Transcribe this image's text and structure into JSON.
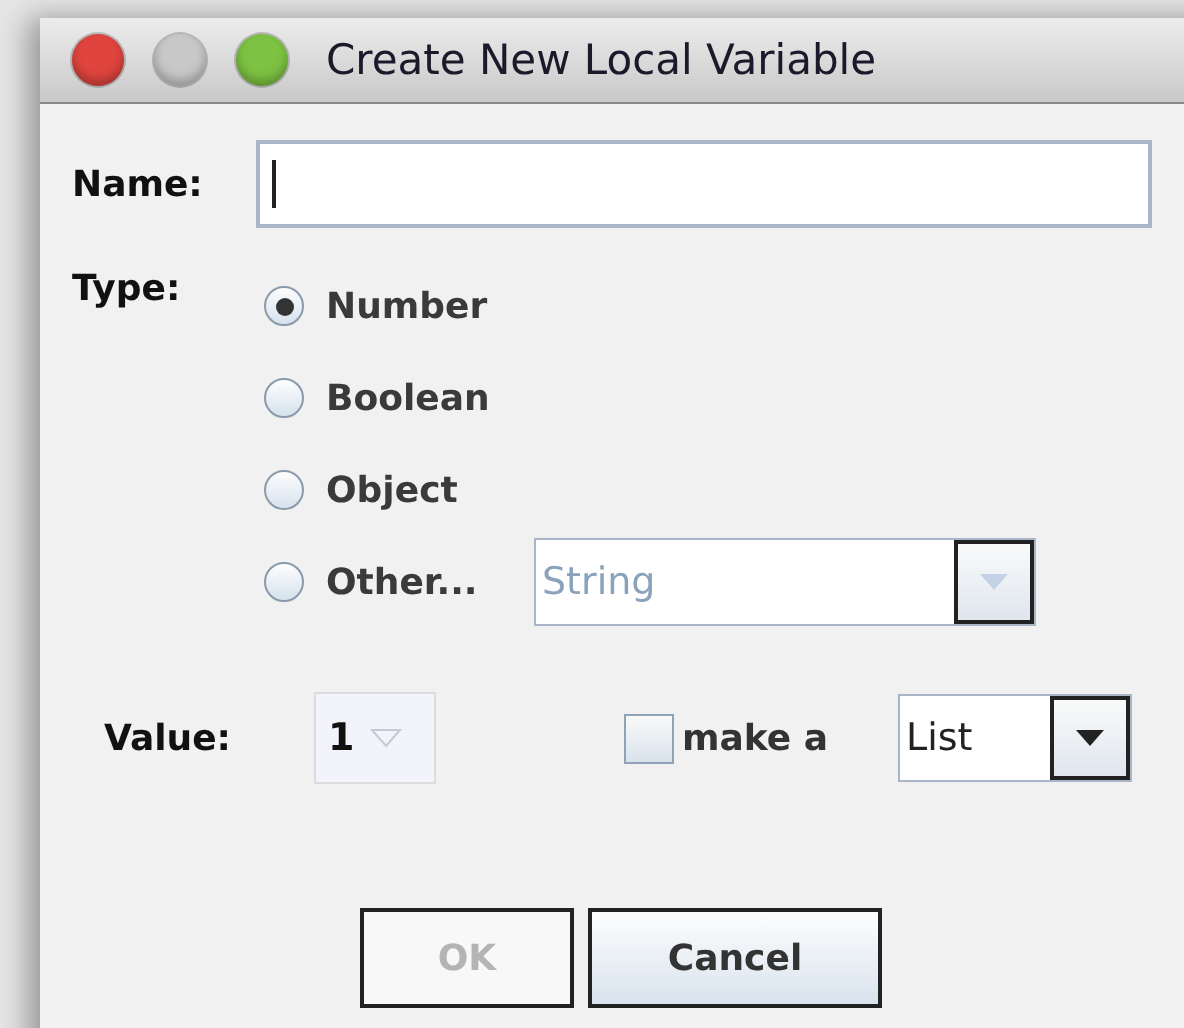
{
  "window": {
    "title": "Create New Local Variable",
    "controls": [
      {
        "color": "#e0443e"
      },
      {
        "color": "#c8c8c8"
      },
      {
        "color": "#7dc242"
      }
    ]
  },
  "name": {
    "label": "Name:",
    "focused": true
  },
  "type": {
    "label": "Type:",
    "options": [
      {
        "label": "Number",
        "selected": true
      },
      {
        "label": "Boolean",
        "selected": false
      },
      {
        "label": "Object",
        "selected": false
      },
      {
        "label": "Other...",
        "selected": false
      }
    ],
    "other_combo": {
      "value": "String",
      "disabled": true
    }
  },
  "value": {
    "label": "Value:",
    "value": "1",
    "disabled": true
  },
  "make_list": {
    "label": "make a",
    "checked": false,
    "combo": {
      "value": "List",
      "disabled": false
    }
  },
  "buttons": [
    {
      "label": "OK",
      "disabled": true
    },
    {
      "label": "Cancel",
      "disabled": false
    }
  ]
}
